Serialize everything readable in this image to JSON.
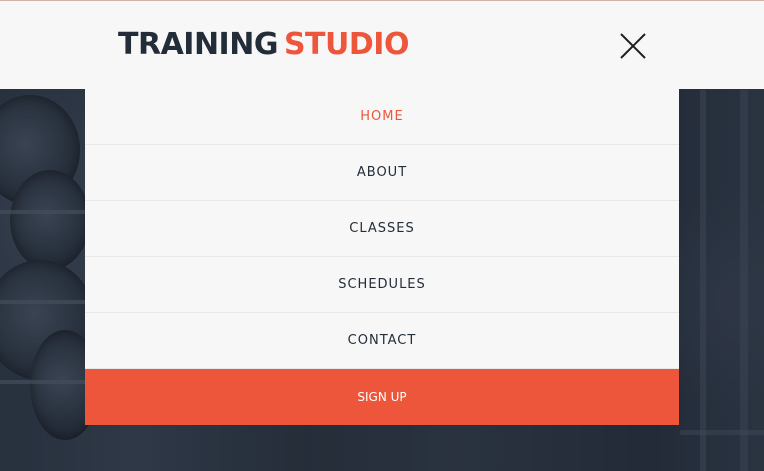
{
  "brand": {
    "part1": "TRAINING",
    "part2": "STUDIO"
  },
  "header": {
    "close_icon": "close-icon"
  },
  "nav": {
    "items": [
      {
        "label": "HOME",
        "active": true
      },
      {
        "label": "ABOUT",
        "active": false
      },
      {
        "label": "CLASSES",
        "active": false
      },
      {
        "label": "SCHEDULES",
        "active": false
      },
      {
        "label": "CONTACT",
        "active": false
      }
    ],
    "signup_label": "SIGN UP"
  },
  "colors": {
    "accent": "#ed563b",
    "dark_text": "#232d39",
    "menu_bg": "#f7f7f7"
  }
}
